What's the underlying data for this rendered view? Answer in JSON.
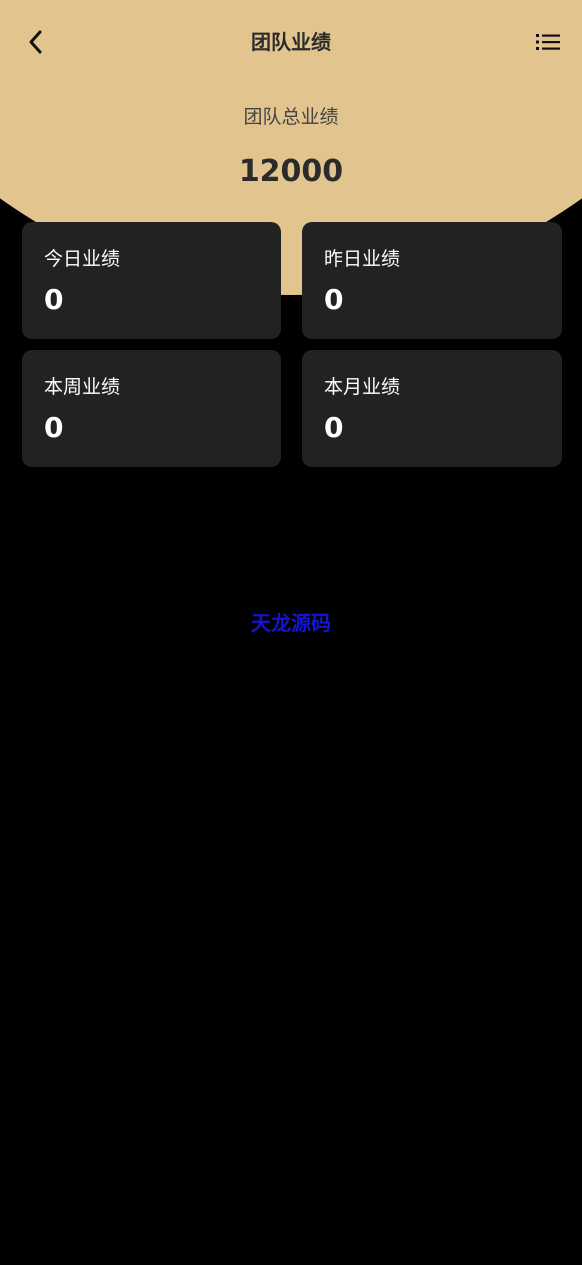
{
  "header": {
    "title": "团队业绩",
    "back_icon": "chevron-left-icon",
    "menu_icon": "list-icon"
  },
  "summary": {
    "label": "团队总业绩",
    "value": "12000"
  },
  "stats": [
    {
      "label": "今日业绩",
      "value": "0"
    },
    {
      "label": "昨日业绩",
      "value": "0"
    },
    {
      "label": "本周业绩",
      "value": "0"
    },
    {
      "label": "本月业绩",
      "value": "0"
    }
  ],
  "watermark": {
    "text": "天龙源码"
  },
  "colors": {
    "hero": "#e2c48e",
    "background": "#000000",
    "card": "#222222",
    "watermark": "#1414d6"
  }
}
